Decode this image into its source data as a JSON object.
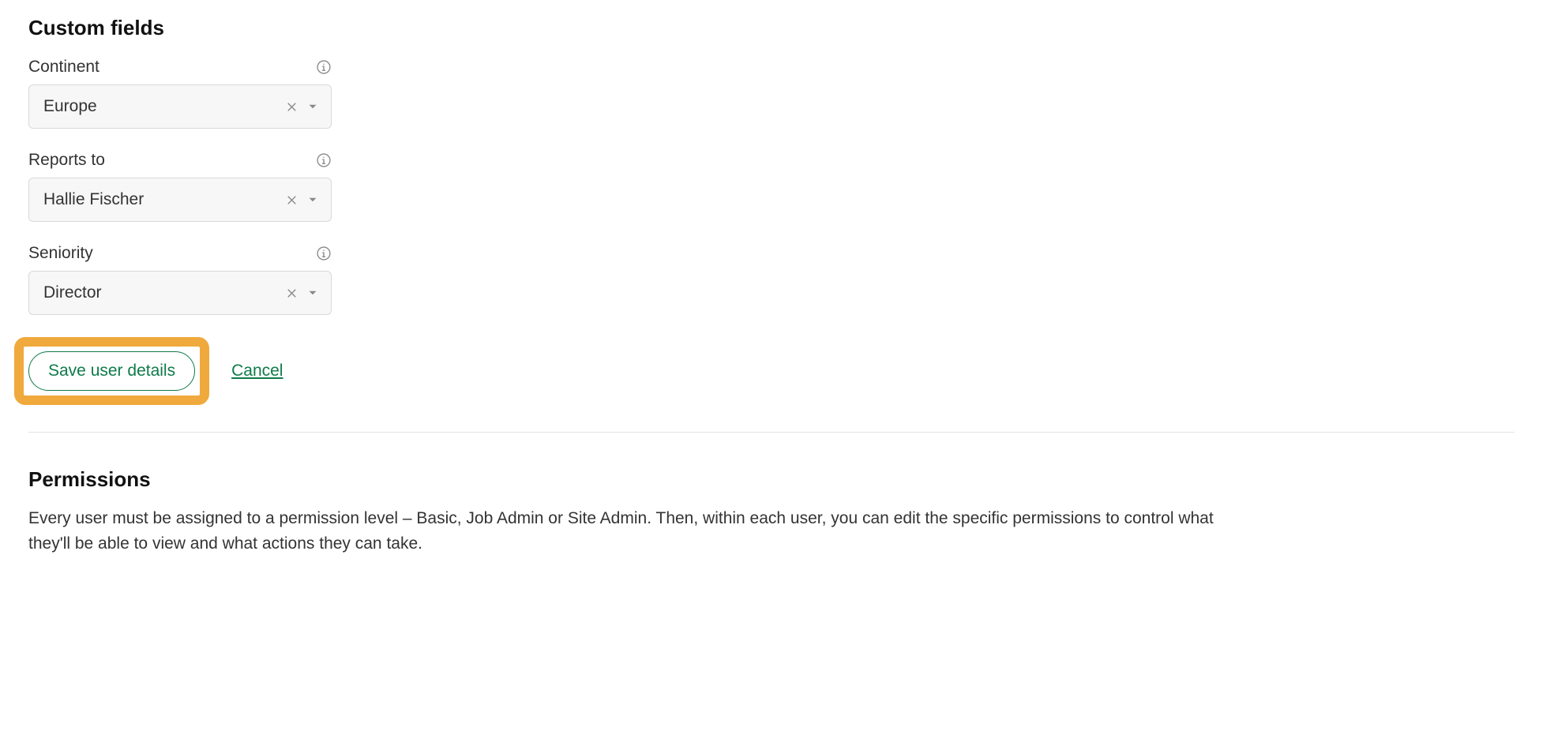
{
  "custom_fields": {
    "heading": "Custom fields",
    "fields": {
      "continent": {
        "label": "Continent",
        "value": "Europe"
      },
      "reports_to": {
        "label": "Reports to",
        "value": "Hallie Fischer"
      },
      "seniority": {
        "label": "Seniority",
        "value": "Director"
      }
    }
  },
  "actions": {
    "save_label": "Save user details",
    "cancel_label": "Cancel"
  },
  "permissions": {
    "heading": "Permissions",
    "description": "Every user must be assigned to a permission level – Basic, Job Admin or Site Admin. Then, within each user, you can edit the specific permissions to control what they'll be able to view and what actions they can take."
  }
}
